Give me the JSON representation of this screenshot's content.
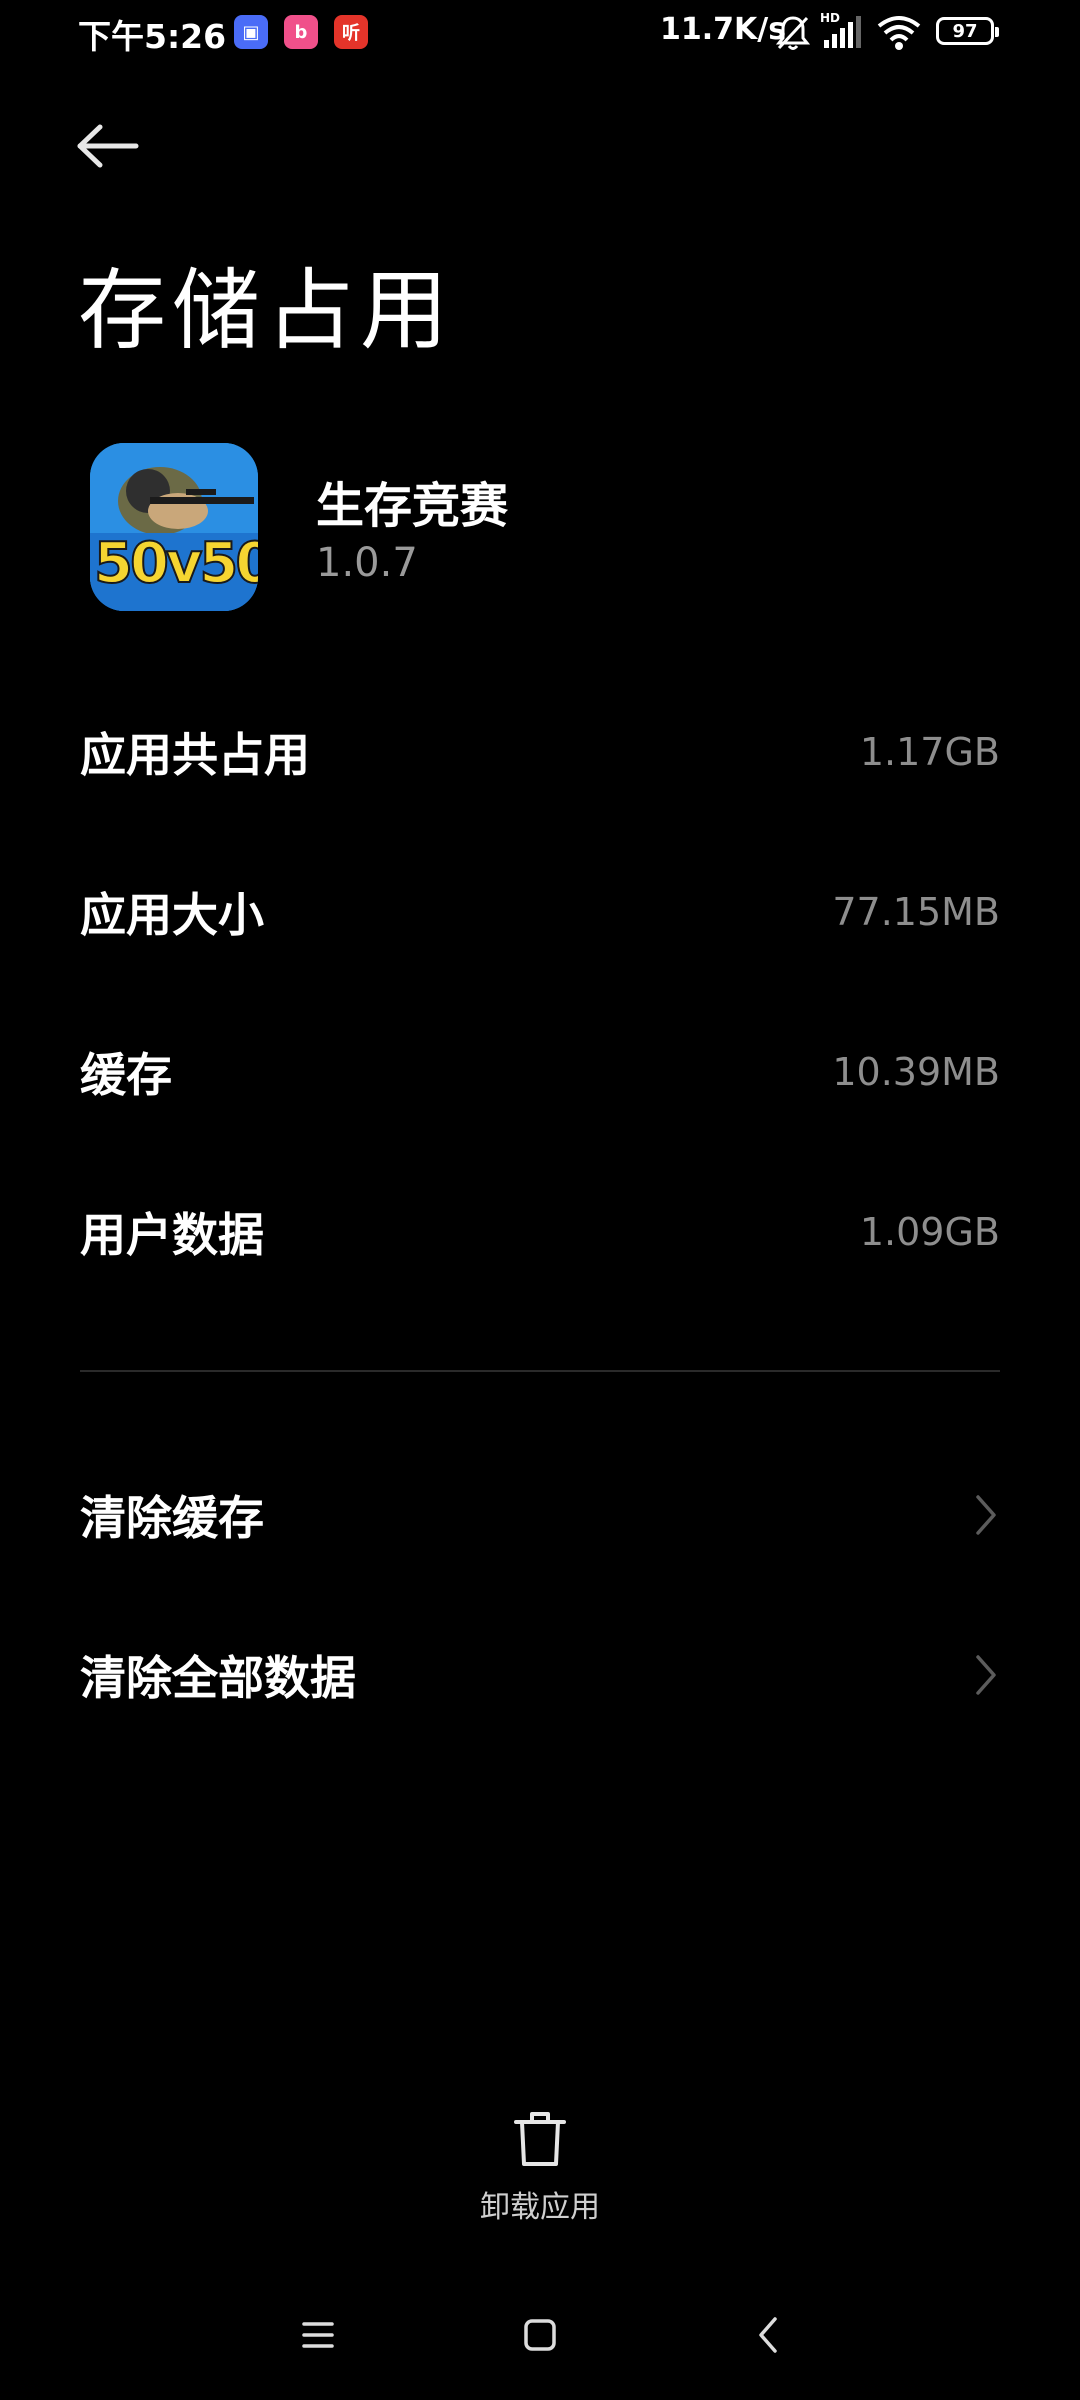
{
  "status_bar": {
    "time": "下午5:26",
    "notif_apps": [
      {
        "name": "chat-app-icon",
        "glyph": "▣",
        "color": "#4a6cf7"
      },
      {
        "name": "bilibili-app-icon",
        "glyph": "b",
        "color": "#f0508a"
      },
      {
        "name": "listen-app-icon",
        "glyph": "听",
        "color": "#e4342a"
      }
    ],
    "net_speed": "11.7K/s",
    "network_badge": "HD",
    "battery": "97"
  },
  "header": {
    "back_icon": "back-arrow-icon",
    "title": "存储占用"
  },
  "app": {
    "name": "生存竞赛",
    "version": "1.0.7",
    "icon_text": "50v50"
  },
  "storage": {
    "items": [
      {
        "label": "应用共占用",
        "value": "1.17GB"
      },
      {
        "label": "应用大小",
        "value": "77.15MB"
      },
      {
        "label": "缓存",
        "value": "10.39MB"
      },
      {
        "label": "用户数据",
        "value": "1.09GB"
      }
    ]
  },
  "actions": {
    "items": [
      {
        "label": "清除缓存",
        "icon": "chevron-right-icon"
      },
      {
        "label": "清除全部数据",
        "icon": "chevron-right-icon"
      }
    ]
  },
  "uninstall": {
    "label": "卸载应用",
    "icon": "trash-icon"
  },
  "navbar": {
    "icons": [
      "menu-icon",
      "home-icon",
      "back-icon"
    ]
  }
}
